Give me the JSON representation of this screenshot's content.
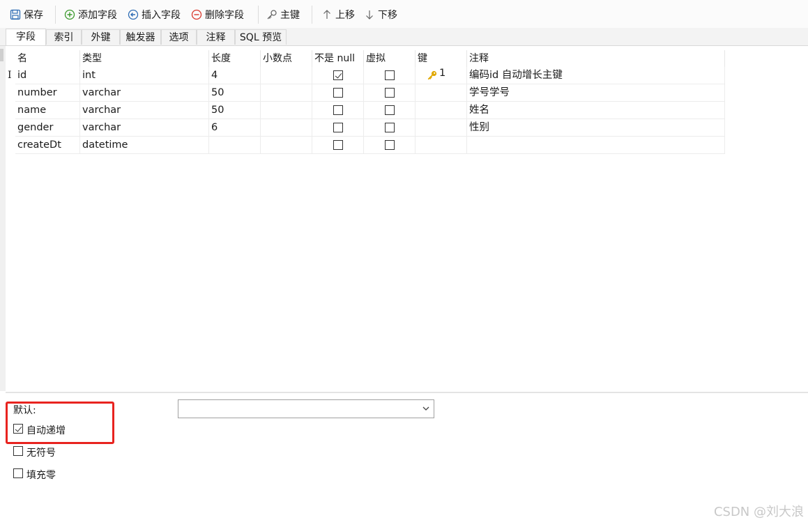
{
  "toolbar": {
    "save": "保存",
    "add_field": "添加字段",
    "insert_field": "插入字段",
    "delete_field": "删除字段",
    "primary_key": "主键",
    "move_up": "上移",
    "move_down": "下移"
  },
  "tabs": [
    "字段",
    "索引",
    "外键",
    "触发器",
    "选项",
    "注释",
    "SQL 预览"
  ],
  "active_tab": "字段",
  "columns": [
    "名",
    "类型",
    "长度",
    "小数点",
    "不是 null",
    "虚拟",
    "键",
    "注释"
  ],
  "cursor_glyph": "I",
  "rows": [
    {
      "name": "id",
      "type": "int",
      "length": "4",
      "decimal": "",
      "not_null": true,
      "virtual": false,
      "key": "1",
      "comment": "编码id 自动增长主键"
    },
    {
      "name": "number",
      "type": "varchar",
      "length": "50",
      "decimal": "",
      "not_null": false,
      "virtual": false,
      "key": "",
      "comment": "学号学号"
    },
    {
      "name": "name",
      "type": "varchar",
      "length": "50",
      "decimal": "",
      "not_null": false,
      "virtual": false,
      "key": "",
      "comment": "姓名"
    },
    {
      "name": "gender",
      "type": "varchar",
      "length": "6",
      "decimal": "",
      "not_null": false,
      "virtual": false,
      "key": "",
      "comment": "性别"
    },
    {
      "name": "createDt",
      "type": "datetime",
      "length": "",
      "decimal": "",
      "not_null": false,
      "virtual": false,
      "key": "",
      "comment": ""
    }
  ],
  "options": {
    "default_label": "默认:",
    "default_value": "",
    "auto_increment": {
      "label": "自动递增",
      "checked": true
    },
    "unsigned": {
      "label": "无符号",
      "checked": false
    },
    "zerofill": {
      "label": "填充零",
      "checked": false
    }
  },
  "colors": {
    "highlight_box": "#e8231f",
    "key_icon": "#e0a800"
  },
  "watermark": "CSDN @刘大浪"
}
